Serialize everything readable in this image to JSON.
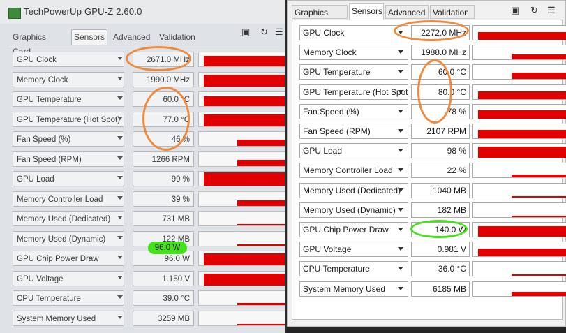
{
  "left": {
    "app_title": "TechPowerUp GPU-Z 2.60.0",
    "tabs": [
      "Graphics Card",
      "Sensors",
      "Advanced",
      "Validation"
    ],
    "active_tab": "Sensors",
    "toolbar": [
      "camera-icon",
      "refresh-icon",
      "menu-icon"
    ],
    "rows": [
      {
        "label": "GPU Clock",
        "value": "2671.0 MHz",
        "fill": 0.75
      },
      {
        "label": "Memory Clock",
        "value": "1990.0 MHz",
        "fill": 0.85
      },
      {
        "label": "GPU Temperature",
        "value": "60.0 °C",
        "fill": 0.7
      },
      {
        "label": "GPU Temperature (Hot Spot)",
        "value": "77.0 °C",
        "fill": 0.85
      },
      {
        "label": "Fan Speed (%)",
        "value": "46 %",
        "fill": 0.45
      },
      {
        "label": "Fan Speed (RPM)",
        "value": "1266 RPM",
        "fill": 0.45
      },
      {
        "label": "GPU Load",
        "value": "99 %",
        "fill": 0.95
      },
      {
        "label": "Memory Controller Load",
        "value": "39 %",
        "fill": 0.4
      },
      {
        "label": "Memory Used (Dedicated)",
        "value": "731 MB",
        "fill": 0.08
      },
      {
        "label": "Memory Used (Dynamic)",
        "value": "122 MB",
        "fill": 0.06
      },
      {
        "label": "GPU Chip Power Draw",
        "value": "96.0 W",
        "fill": 0.85
      },
      {
        "label": "GPU Voltage",
        "value": "1.150 V",
        "fill": 0.85
      },
      {
        "label": "CPU Temperature",
        "value": "39.0 °C",
        "fill": 0.15
      },
      {
        "label": "System Memory Used",
        "value": "3259 MB",
        "fill": 0.1
      }
    ]
  },
  "right": {
    "tabs": [
      "Graphics Card",
      "Sensors",
      "Advanced",
      "Validation"
    ],
    "active_tab": "Sensors",
    "toolbar": [
      "camera-icon",
      "refresh-icon",
      "menu-icon"
    ],
    "rows": [
      {
        "label": "GPU Clock",
        "value": "2272.0 MHz",
        "fill": 0.55
      },
      {
        "label": "Memory Clock",
        "value": "1988.0 MHz",
        "fill": 0.35
      },
      {
        "label": "GPU Temperature",
        "value": "60.0 °C",
        "fill": 0.45
      },
      {
        "label": "GPU Temperature (Hot Spot)",
        "value": "80.0 °C",
        "fill": 0.55
      },
      {
        "label": "Fan Speed (%)",
        "value": "78 %",
        "fill": 0.6
      },
      {
        "label": "Fan Speed (RPM)",
        "value": "2107 RPM",
        "fill": 0.6
      },
      {
        "label": "GPU Load",
        "value": "98 %",
        "fill": 0.8
      },
      {
        "label": "Memory Controller Load",
        "value": "22 %",
        "fill": 0.2
      },
      {
        "label": "Memory Used (Dedicated)",
        "value": "1040 MB",
        "fill": 0.1
      },
      {
        "label": "Memory Used (Dynamic)",
        "value": "182 MB",
        "fill": 0.08
      },
      {
        "label": "GPU Chip Power Draw",
        "value": "140.0 W",
        "fill": 0.75
      },
      {
        "label": "GPU Voltage",
        "value": "0.981 V",
        "fill": 0.55
      },
      {
        "label": "CPU Temperature",
        "value": "36.0 °C",
        "fill": 0.1
      },
      {
        "label": "System Memory Used",
        "value": "6185 MB",
        "fill": 0.3
      }
    ]
  },
  "annotation_colors": {
    "orange": "#f08a3c",
    "green": "#44e21a",
    "graph_red": "#e00000"
  }
}
